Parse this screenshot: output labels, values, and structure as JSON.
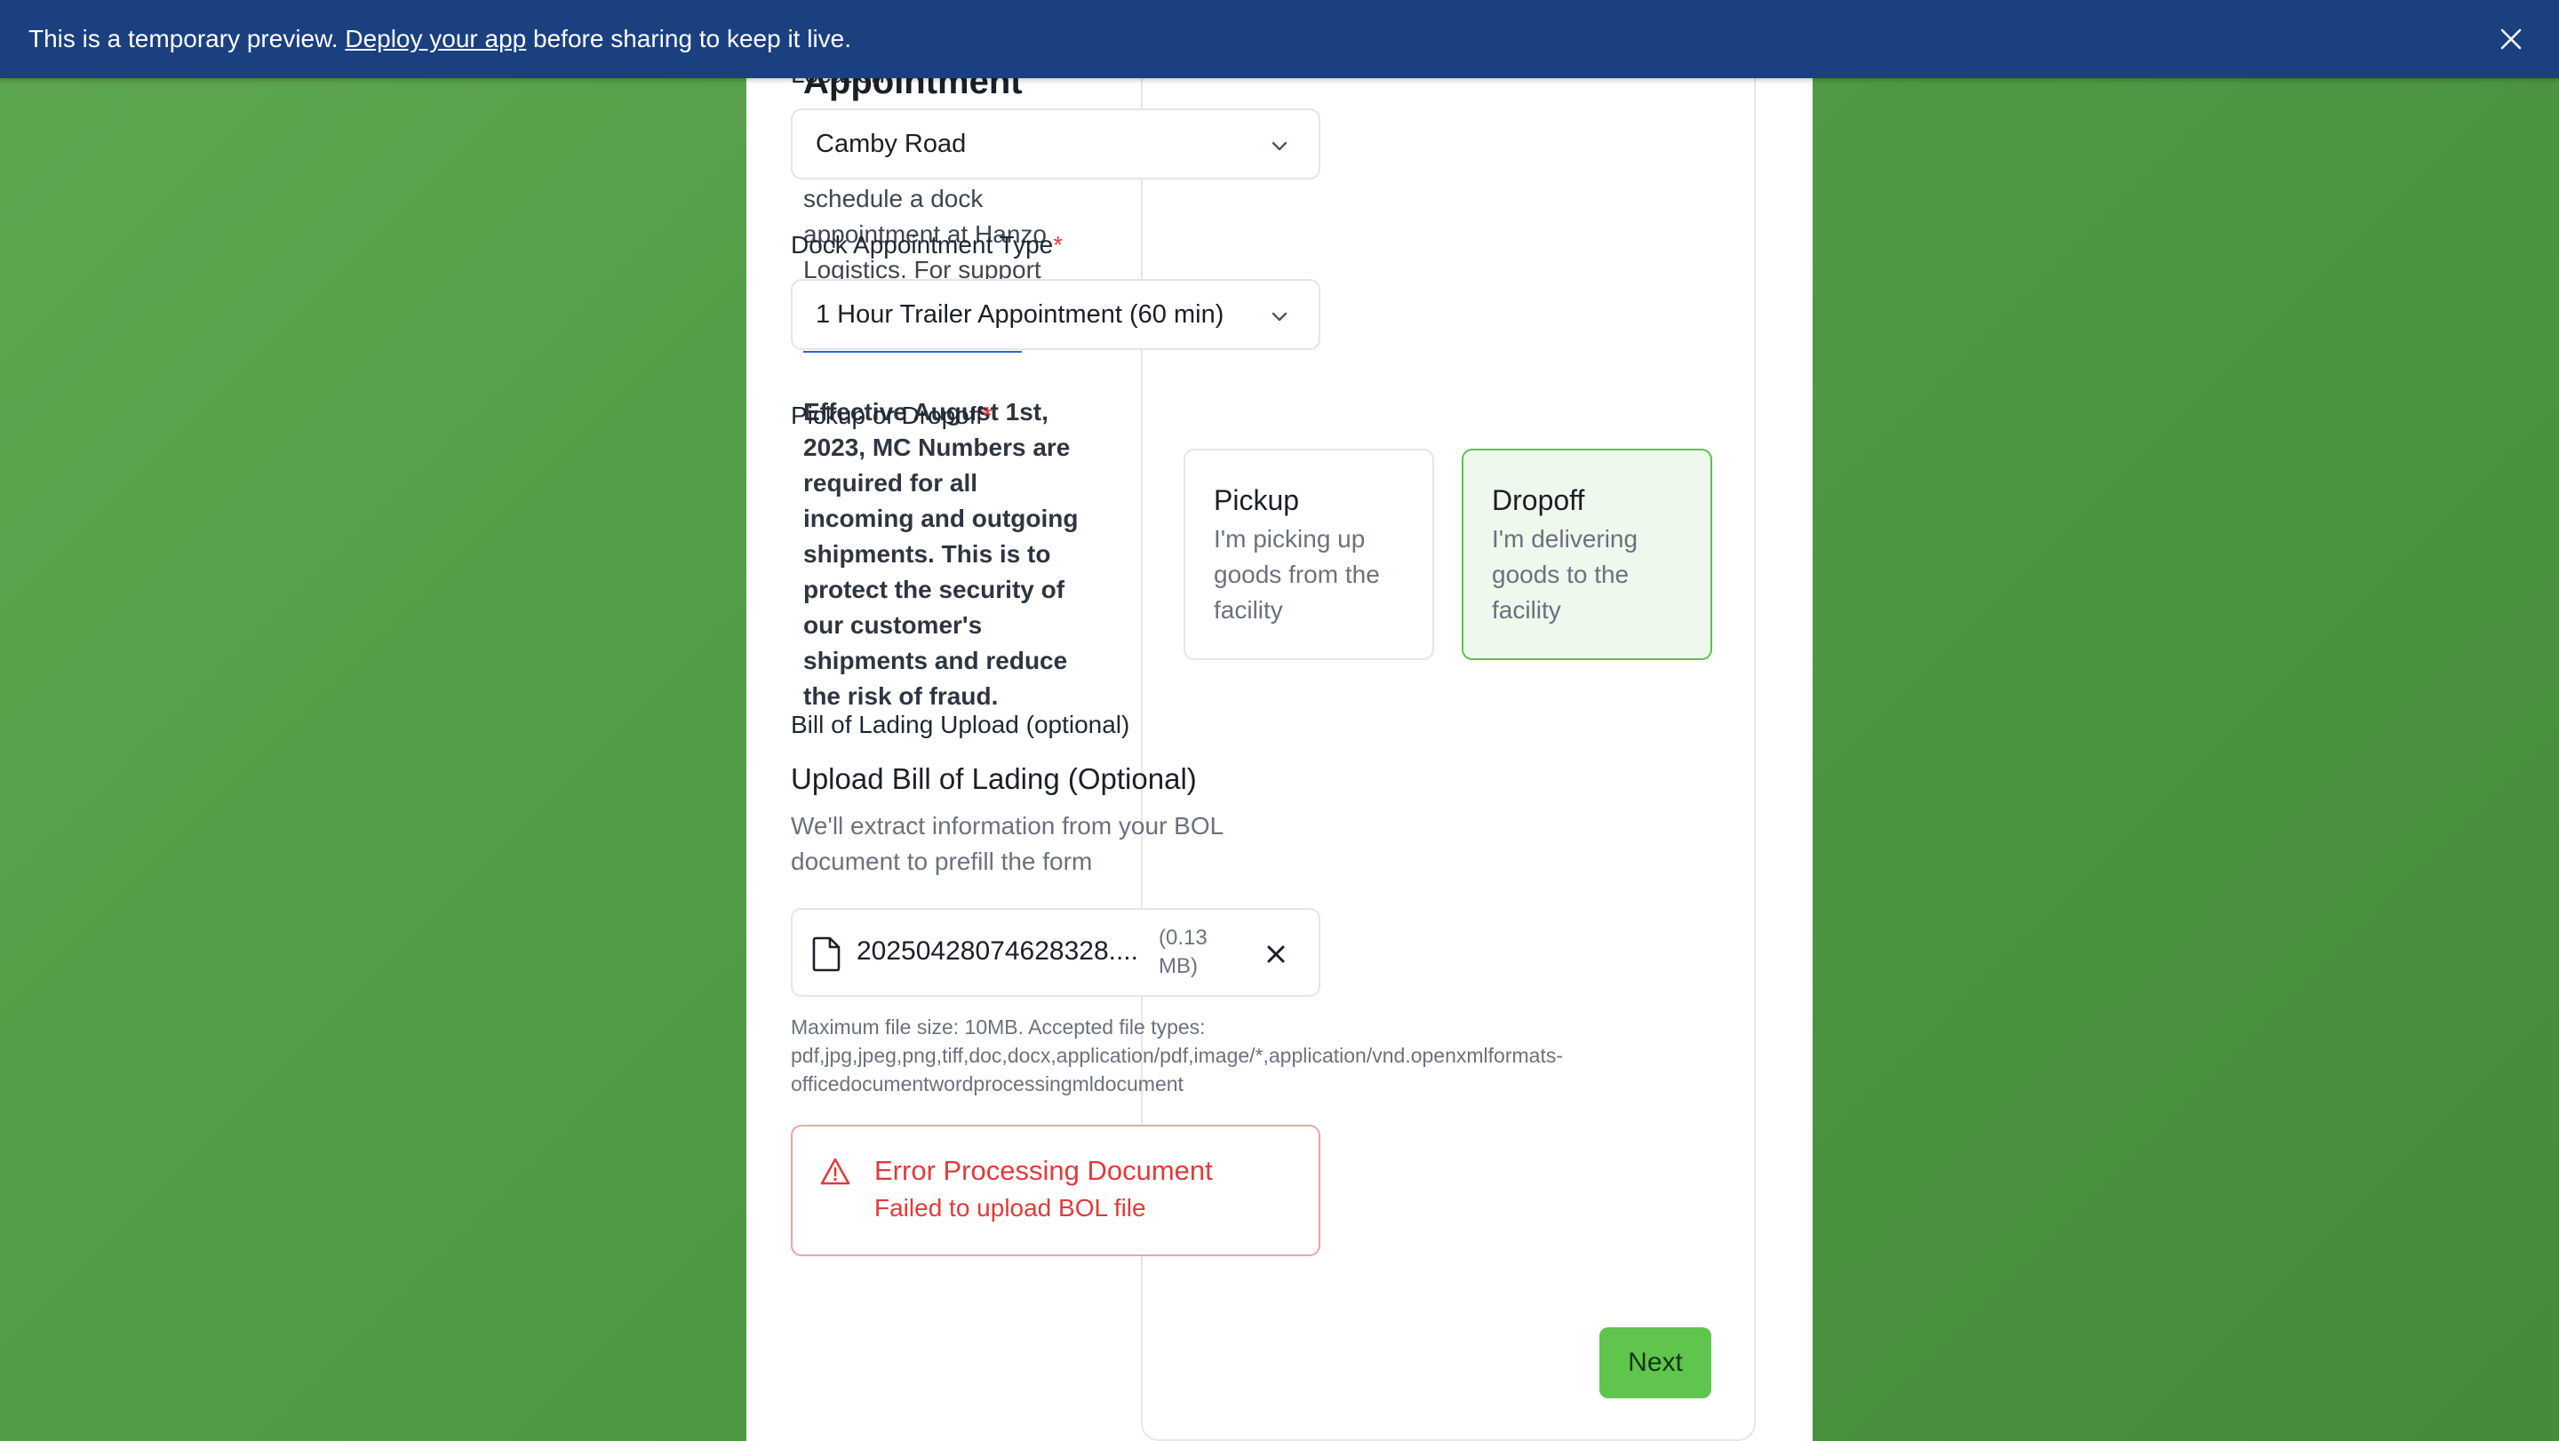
{
  "banner": {
    "text_before": "This is a temporary preview. ",
    "link": "Deploy your app",
    "text_after": " before sharing to keep it live."
  },
  "intro": {
    "title": "Appointment",
    "paragraph_before_link": "Please use this form to schedule a dock appointment at Hanzo Logistics. For support using this page, please ",
    "link": "check out this video",
    "paragraph_after_link": ".",
    "notice": "Effective August 1st, 2023, MC Numbers are required for all incoming and outgoing shipments. This is to protect the security of our customer's shipments and reduce the risk of fraud."
  },
  "form": {
    "location": {
      "label": "Location",
      "value": "Camby Road"
    },
    "dock_type": {
      "label": "Dock Appointment Type",
      "required_mark": "*",
      "value": "1 Hour Trailer Appointment (60 min)"
    },
    "pickup_dropoff": {
      "label": "Pickup or Dropoff",
      "required_mark": "*",
      "options": [
        {
          "title": "Pickup",
          "desc": "I'm picking up goods from the facility",
          "selected": false
        },
        {
          "title": "Dropoff",
          "desc": "I'm delivering goods to the facility",
          "selected": true
        }
      ]
    },
    "bol": {
      "label": "Bill of Lading Upload (optional)",
      "heading": "Upload Bill of Lading (Optional)",
      "description": "We'll extract information from your BOL document to prefill the form",
      "file_name": "20250428074628328....",
      "file_size": "(0.13 MB)",
      "hint_line1": "Maximum file size: 10MB. Accepted file types:",
      "hint_line2": "pdf,jpg,jpeg,png,tiff,doc,docx,application/pdf,image/*,application/vnd.openxmlformats-",
      "hint_line3": "officedocumentwordprocessingmldocument"
    },
    "error": {
      "title": "Error Processing Document",
      "message": "Failed to upload BOL file"
    },
    "next_label": "Next"
  },
  "colors": {
    "banner_bg": "#1b4080",
    "accent_green": "#5fc54d",
    "error_red": "#df3b3b",
    "link_blue": "#2a62d6"
  }
}
